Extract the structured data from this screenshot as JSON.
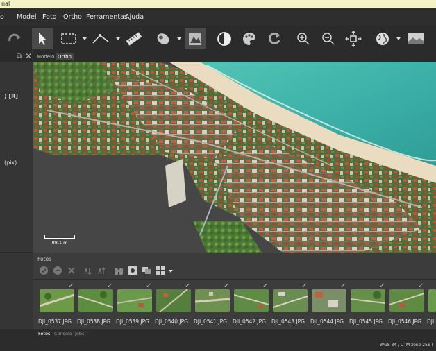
{
  "window": {
    "title": "nal"
  },
  "menu": [
    "o",
    "Model",
    "Foto",
    "Ortho",
    "Ferramentas",
    "Ajuda"
  ],
  "left_panel": {
    "line1": ") [R]",
    "line2": "(pix)"
  },
  "view_tabs": [
    "Modelo",
    "Ortho"
  ],
  "scale_bar": {
    "label": "98.1 m"
  },
  "fotos": {
    "title": "Fotos",
    "thumbnails": [
      "DJI_0537.JPG",
      "DJI_0538.JPG",
      "DJI_0539.JPG",
      "DJI_0540.JPG",
      "DJI_0541.JPG",
      "DJI_0542.JPG",
      "DJI_0543.JPG",
      "DJI_0544.JPG",
      "DJI_0545.JPG",
      "DJI_0546.JPG",
      "DJI"
    ]
  },
  "bottom_tabs": [
    "Fotos",
    "Consola",
    "Jobs"
  ],
  "status": {
    "crs": "WGS 84 / UTM zone 25S ("
  },
  "colors": {
    "accent": "#4a4a4a",
    "sea": "#3fb5ad",
    "sand": "#e9dcc0"
  }
}
